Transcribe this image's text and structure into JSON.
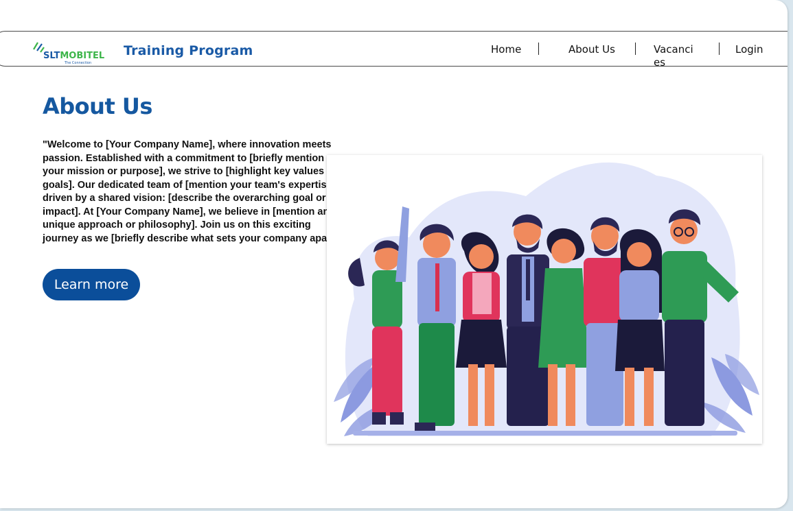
{
  "brand": {
    "logo_text": "SLTMOBITEL",
    "logo_tagline": "The Connection",
    "title": "Training Program"
  },
  "nav": {
    "items": [
      {
        "label": "Home"
      },
      {
        "label": "About Us"
      },
      {
        "label": "Vacancies"
      },
      {
        "label": "Login"
      }
    ]
  },
  "main": {
    "heading": "About Us",
    "paragraph": "\"Welcome to [Your Company Name], where innovation meets passion. Established with a commitment to [briefly mention your mission or purpose], we strive to [highlight key values or goals]. Our dedicated team of [mention your team's expertise] is driven by a shared vision: [describe the overarching goal or impact]. At [Your Company Name], we believe in [mention any unique approach or philosophy]. Join us on this exciting journey as we [briefly describe what sets your company apart].\"",
    "cta_label": "Learn more"
  },
  "colors": {
    "brand_blue": "#1a5aa6",
    "button_blue": "#0b4e9a",
    "heading_blue": "#1558a0",
    "logo_green": "#3db54a"
  }
}
